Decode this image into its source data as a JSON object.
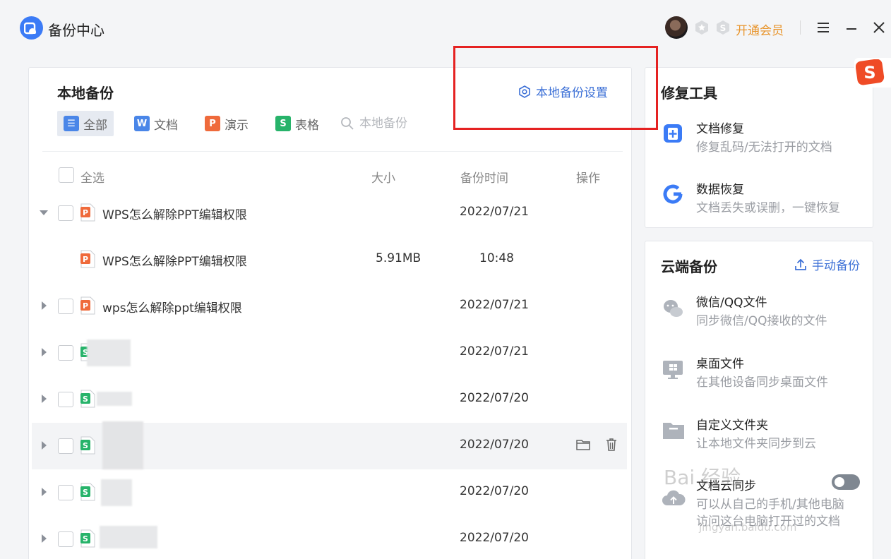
{
  "app": {
    "title": "备份中心",
    "vip_label": "开通会员"
  },
  "local_backup": {
    "title": "本地备份",
    "settings_label": "本地备份设置",
    "filters": [
      {
        "label": "全部",
        "type_letter": "☰"
      },
      {
        "label": "文档",
        "type_letter": "W"
      },
      {
        "label": "演示",
        "type_letter": "P"
      },
      {
        "label": "表格",
        "type_letter": "S"
      }
    ],
    "search_placeholder": "本地备份",
    "columns": {
      "select_all": "全选",
      "size": "大小",
      "time": "备份时间",
      "action": "操作"
    },
    "rows": [
      {
        "name": "WPS怎么解除PPT编辑权限",
        "type": "ppt",
        "size": "",
        "time": "2022/07/21",
        "expanded": true
      },
      {
        "name": "WPS怎么解除PPT编辑权限",
        "type": "ppt",
        "size": "5.91MB",
        "time": "10:48",
        "child": true
      },
      {
        "name": "wps怎么解除ppt编辑权限",
        "type": "ppt",
        "size": "",
        "time": "2022/07/21"
      },
      {
        "name": "",
        "type": "xls",
        "size": "",
        "time": "2022/07/21"
      },
      {
        "name": "",
        "type": "xls",
        "size": "",
        "time": "2022/07/20"
      },
      {
        "name": "",
        "type": "xls",
        "size": "",
        "time": "2022/07/20",
        "hover": true
      },
      {
        "name": "",
        "type": "xls",
        "size": "",
        "time": "2022/07/20"
      },
      {
        "name": "",
        "type": "xls",
        "size": "",
        "time": "2022/07/20"
      }
    ]
  },
  "repair_tools": {
    "title": "修复工具",
    "items": [
      {
        "name": "文档修复",
        "desc": "修复乱码/无法打开的文档"
      },
      {
        "name": "数据恢复",
        "desc": "文档丢失或误删，一键恢复"
      }
    ]
  },
  "cloud_backup": {
    "title": "云端备份",
    "manual_label": "手动备份",
    "items": [
      {
        "name": "微信/QQ文件",
        "desc": "同步微信/QQ接收的文件"
      },
      {
        "name": "桌面文件",
        "desc": "在其他设备同步桌面文件"
      },
      {
        "name": "自定义文件夹",
        "desc": "让本地文件夹同步到云"
      },
      {
        "name": "文档云同步",
        "desc": "可以从自己的手机/其他电脑",
        "desc2": "访问这台电脑打开过的文档"
      }
    ]
  },
  "watermark": {
    "text": "Bai 经验",
    "sub": "jingyan.baidu.com"
  },
  "colors": {
    "accent": "#3b6fd6",
    "vip": "#e8952d",
    "highlight": "#e52222",
    "ppt": "#ef6a3b",
    "xls": "#27b36a",
    "doc": "#4a86e8"
  }
}
